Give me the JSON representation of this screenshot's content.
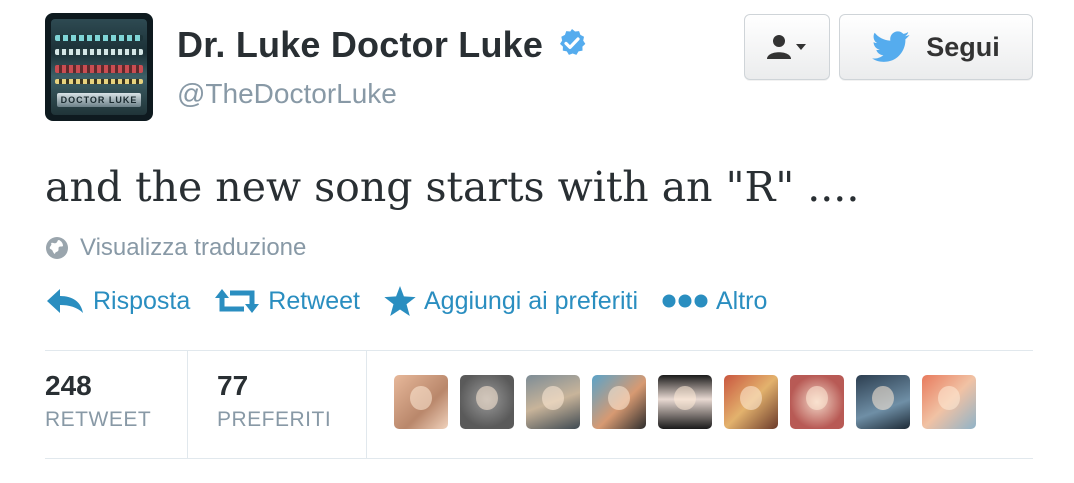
{
  "user": {
    "display_name": "Dr. Luke Doctor Luke",
    "handle": "@TheDoctorLuke",
    "avatar_icon": "avatar-image",
    "avatar_text": "DOCTOR LUKE"
  },
  "buttons": {
    "user_dropdown_icon": "user-dropdown-icon",
    "follow_label": "Segui"
  },
  "tweet": {
    "text": "and the new song starts with an \"R\" ....",
    "translate_label": "Visualizza traduzione"
  },
  "actions": [
    {
      "label": "Risposta",
      "icon": "reply-icon"
    },
    {
      "label": "Retweet",
      "icon": "retweet-icon"
    },
    {
      "label": "Aggiungi ai preferiti",
      "icon": "star-icon"
    },
    {
      "label": "Altro",
      "icon": "more-icon"
    }
  ],
  "stats": {
    "retweets": {
      "value": "248",
      "label": "RETWEET"
    },
    "favorites": {
      "value": "77",
      "label": "PREFERITI"
    }
  },
  "colors": {
    "accent": "#2a8ec0",
    "twitter_blue": "#55acee",
    "muted": "#8899a6"
  }
}
